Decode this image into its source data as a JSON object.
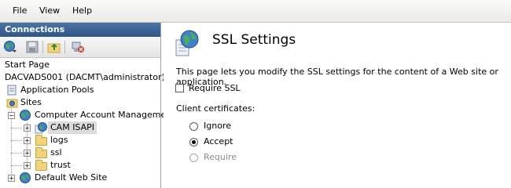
{
  "menubar": {
    "items": [
      "File",
      "View",
      "Help"
    ]
  },
  "connections": {
    "header": "Connections",
    "tree": {
      "start_page": "Start Page",
      "server": "DACVADS001 (DACMT\\administrator)",
      "app_pools": "Application Pools",
      "sites": "Sites",
      "site": "Computer Account Management",
      "children": [
        "CAM ISAPI",
        "logs",
        "ssl",
        "trust"
      ],
      "default_site": "Default Web Site"
    }
  },
  "ssl": {
    "title": "SSL Settings",
    "description": "This page lets you modify the SSL settings for the content of a Web site or application.",
    "require_ssl_label": "Require SSL",
    "require_ssl_checked": false,
    "client_cert_label": "Client certificates:",
    "options": [
      "Ignore",
      "Accept",
      "Require"
    ],
    "selected_option": "Accept"
  }
}
